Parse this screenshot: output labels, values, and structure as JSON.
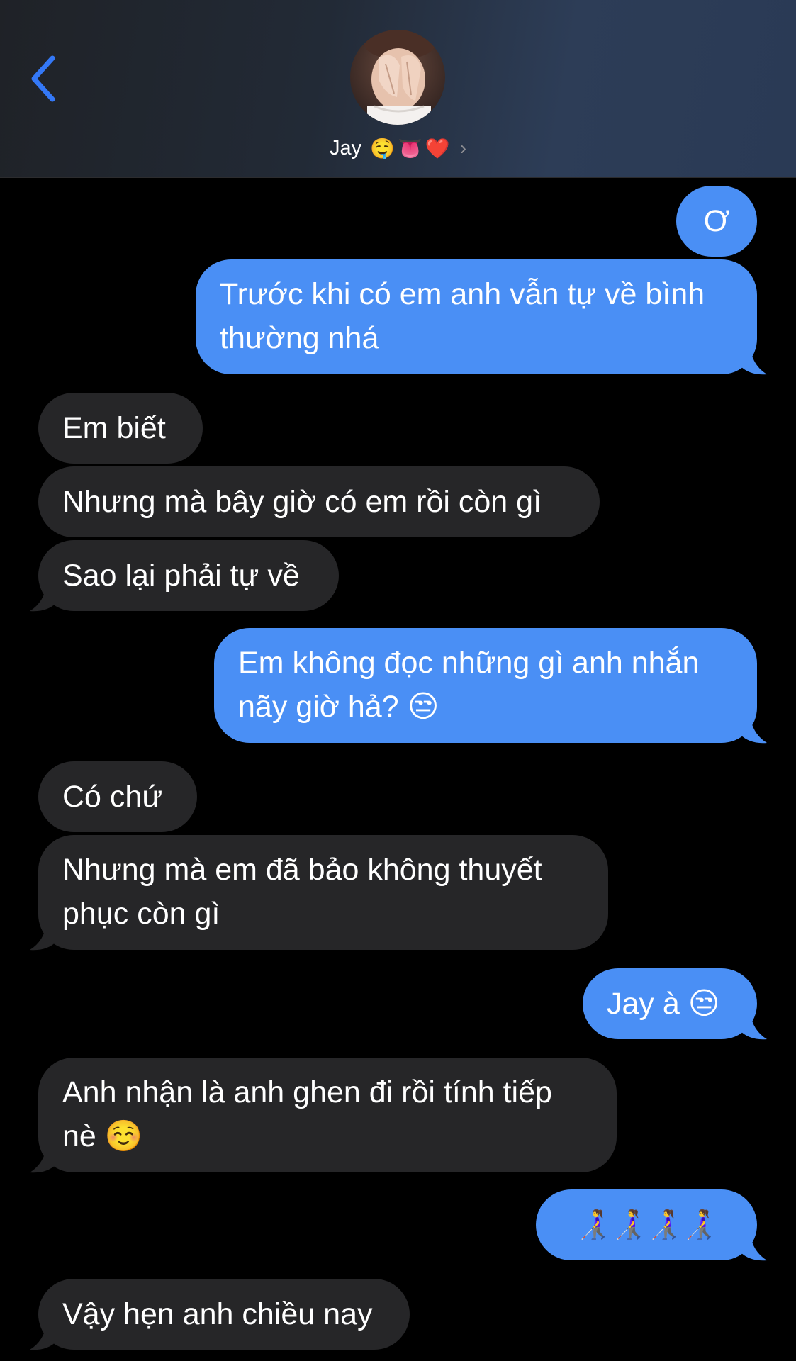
{
  "header": {
    "contact_name": "Jay",
    "name_emojis": "🤤👅❤️",
    "chevron": "›",
    "back_icon": "chevron-left-icon",
    "back_color": "#3478f6"
  },
  "colors": {
    "sent_bubble": "#4a8ff5",
    "received_bubble": "#262628",
    "background": "#000000"
  },
  "messages": [
    {
      "direction": "sent",
      "text": "Ơ"
    },
    {
      "direction": "sent",
      "text": "Trước khi có em anh vẫn tự về bình thường nhá"
    },
    {
      "direction": "received",
      "text": "Em biết"
    },
    {
      "direction": "received",
      "text": "Nhưng mà bây giờ có em rồi còn gì"
    },
    {
      "direction": "received",
      "text": "Sao lại phải tự về"
    },
    {
      "direction": "sent",
      "text": "Em không đọc những gì anh nhắn nãy giờ hả? 😒"
    },
    {
      "direction": "received",
      "text": "Có chứ"
    },
    {
      "direction": "received",
      "text": "Nhưng mà em đã bảo không thuyết phục còn gì"
    },
    {
      "direction": "sent",
      "text": "Jay à 😒"
    },
    {
      "direction": "received",
      "text": "Anh nhận là anh ghen đi rồi tính tiếp nè ☺️"
    },
    {
      "direction": "sent",
      "text": "👩‍🦯👩‍🦯👩‍🦯👩‍🦯"
    },
    {
      "direction": "received",
      "text": "Vậy hẹn anh chiều nay"
    }
  ]
}
